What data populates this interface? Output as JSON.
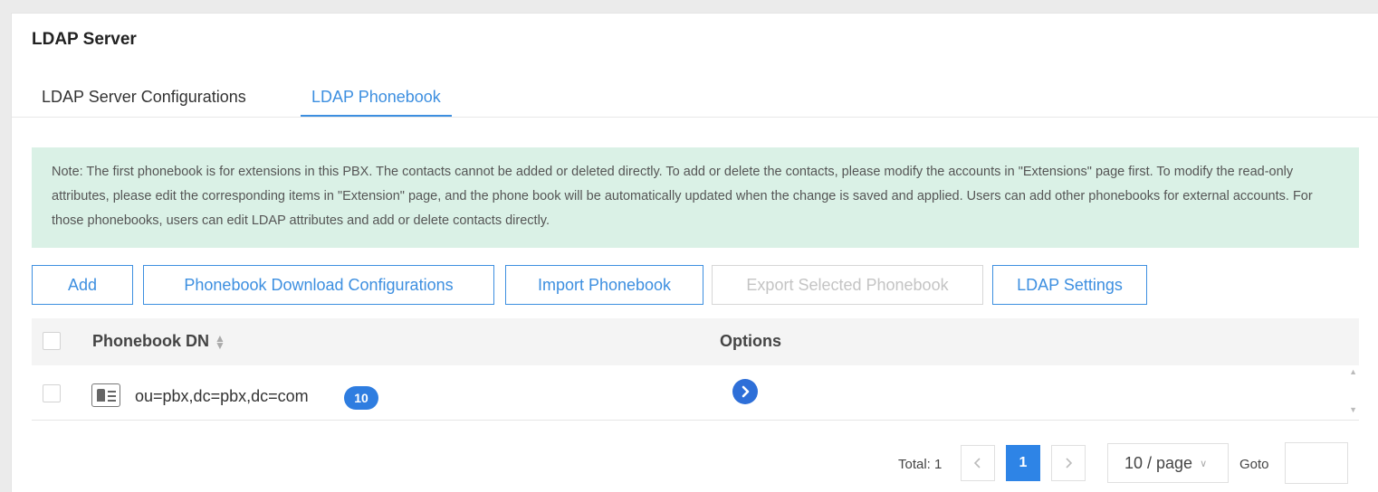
{
  "header": {
    "title": "LDAP Server"
  },
  "tabs": [
    {
      "label": "LDAP Server Configurations",
      "active": false
    },
    {
      "label": "LDAP Phonebook",
      "active": true
    }
  ],
  "note": "Note: The first phonebook is for extensions in this PBX. The contacts cannot be added or deleted directly. To add or delete the contacts, please modify the accounts in \"Extensions\" page first. To modify the read-only attributes, please edit the corresponding items in \"Extension\" page, and the phone book will be automatically updated when the change is saved and applied. Users can add other phonebooks for external accounts. For those phonebooks, users can edit LDAP attributes and add or delete contacts directly.",
  "toolbar": {
    "add": "Add",
    "download_config": "Phonebook Download Configurations",
    "import": "Import Phonebook",
    "export": "Export Selected Phonebook",
    "settings": "LDAP Settings"
  },
  "table": {
    "columns": {
      "dn": "Phonebook DN",
      "options": "Options"
    },
    "rows": [
      {
        "dn": "ou=pbx,dc=pbx,dc=com",
        "count": "10"
      }
    ]
  },
  "pagination": {
    "total": "Total: 1",
    "current_page": "1",
    "page_size": "10 / page",
    "goto_label": "Goto",
    "goto_value": ""
  },
  "colors": {
    "accent": "#3d8fe0",
    "note_bg": "#daf1e6",
    "badge": "#2e7de0"
  }
}
